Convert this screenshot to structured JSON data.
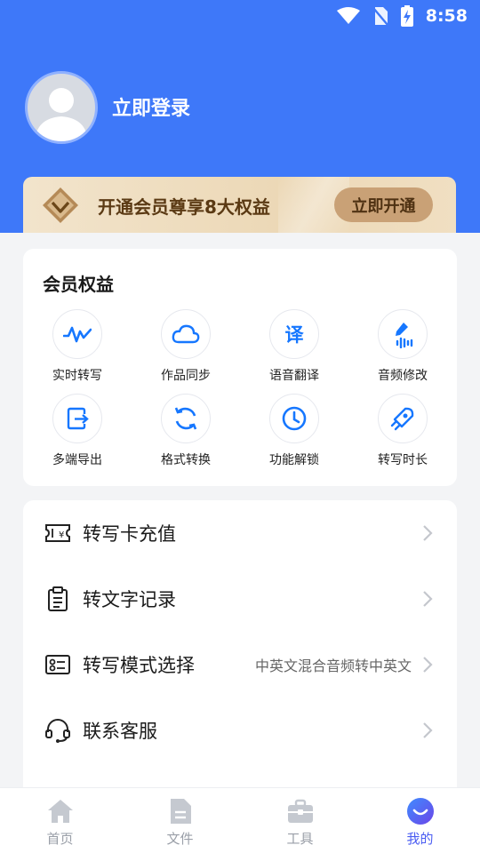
{
  "status_bar": {
    "time": "8:58"
  },
  "colors": {
    "primary": "#3e78f9",
    "vip_gold": "#c9a176",
    "tab_active": "#4a5cf2"
  },
  "profile": {
    "login_text": "立即登录",
    "avatar_icon": "default-user-avatar"
  },
  "vip_banner": {
    "text": "开通会员尊享8大权益",
    "button_label": "立即开通",
    "icon": "diamond-crown-icon"
  },
  "benefits": {
    "title": "会员权益",
    "items": [
      {
        "label": "实时转写",
        "icon": "waveform-icon"
      },
      {
        "label": "作品同步",
        "icon": "cloud-icon"
      },
      {
        "label": "语音翻译",
        "icon": "translate-icon",
        "glyph": "译"
      },
      {
        "label": "音频修改",
        "icon": "audio-edit-icon"
      },
      {
        "label": "多端导出",
        "icon": "export-icon"
      },
      {
        "label": "格式转换",
        "icon": "convert-icon"
      },
      {
        "label": "功能解锁",
        "icon": "clock-icon"
      },
      {
        "label": "转写时长",
        "icon": "rocket-icon"
      }
    ]
  },
  "menu": {
    "items": [
      {
        "label": "转写卡充值",
        "value": "",
        "icon": "ticket-icon"
      },
      {
        "label": "转文字记录",
        "value": "",
        "icon": "clipboard-icon"
      },
      {
        "label": "转写模式选择",
        "value": "中英文混合音频转中英文",
        "icon": "mode-select-icon"
      },
      {
        "label": "联系客服",
        "value": "",
        "icon": "headset-icon"
      }
    ]
  },
  "tabbar": {
    "tabs": [
      {
        "label": "首页",
        "icon": "home-icon",
        "active": false
      },
      {
        "label": "文件",
        "icon": "file-icon",
        "active": false
      },
      {
        "label": "工具",
        "icon": "toolbox-icon",
        "active": false
      },
      {
        "label": "我的",
        "icon": "smile-icon",
        "active": true
      }
    ]
  }
}
